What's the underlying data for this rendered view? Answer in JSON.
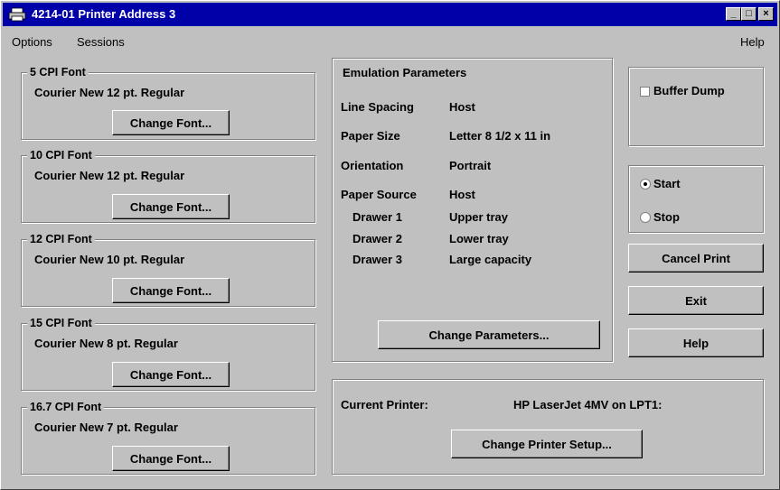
{
  "window": {
    "title": "4214-01 Printer Address 3",
    "minimize": "_",
    "maximize": "□",
    "close": "×"
  },
  "menu": {
    "options": "Options",
    "sessions": "Sessions",
    "help": "Help"
  },
  "fonts": [
    {
      "group": "5 CPI Font",
      "value": "Courier New 12 pt. Regular",
      "button": "Change Font..."
    },
    {
      "group": "10 CPI Font",
      "value": "Courier New 12 pt. Regular",
      "button": "Change Font..."
    },
    {
      "group": "12 CPI Font",
      "value": "Courier New 10 pt. Regular",
      "button": "Change Font..."
    },
    {
      "group": "15 CPI Font",
      "value": "Courier New 8 pt. Regular",
      "button": "Change Font..."
    },
    {
      "group": "16.7 CPI Font",
      "value": "Courier New 7 pt. Regular",
      "button": "Change Font..."
    }
  ],
  "emulation": {
    "title": "Emulation Parameters",
    "line_spacing_label": "Line Spacing",
    "line_spacing_value": "Host",
    "paper_size_label": "Paper Size",
    "paper_size_value": "Letter 8 1/2 x 11 in",
    "orientation_label": "Orientation",
    "orientation_value": "Portrait",
    "paper_source_label": "Paper Source",
    "paper_source_value": "Host",
    "drawers": [
      {
        "label": "Drawer 1",
        "value": "Upper tray"
      },
      {
        "label": "Drawer 2",
        "value": "Lower tray"
      },
      {
        "label": "Drawer 3",
        "value": "Large capacity"
      }
    ],
    "button": "Change Parameters..."
  },
  "printer": {
    "label": "Current Printer:",
    "value": "HP LaserJet 4MV on LPT1:",
    "button": "Change Printer Setup..."
  },
  "side": {
    "buffer_dump": "Buffer Dump",
    "start": "Start",
    "stop": "Stop",
    "cancel_print": "Cancel Print",
    "exit": "Exit",
    "help": "Help"
  }
}
